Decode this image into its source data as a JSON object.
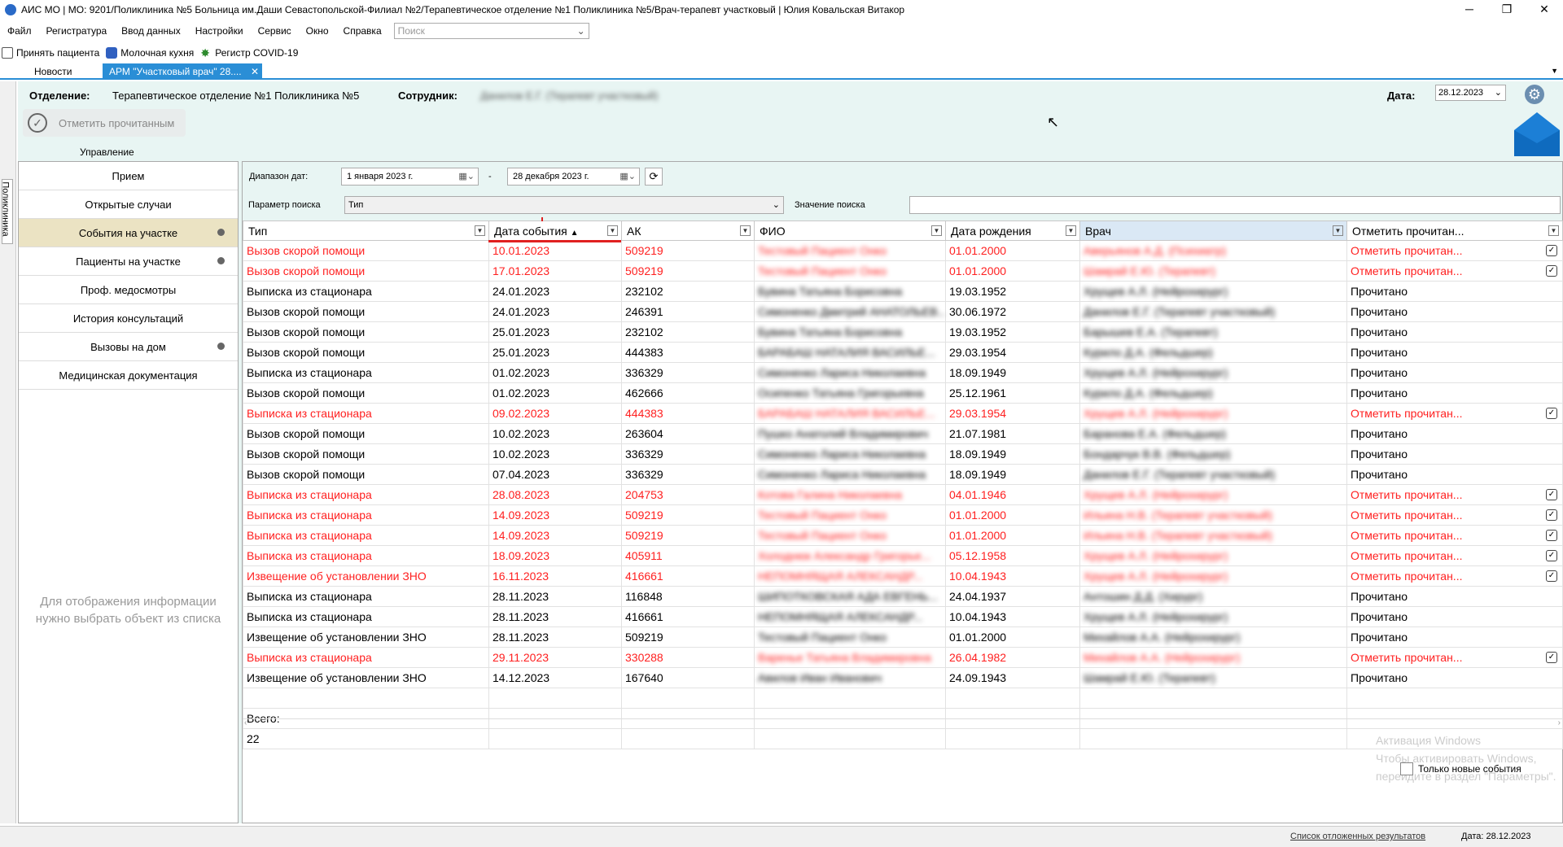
{
  "window": {
    "title": "АИС МО | МО: 9201/Поликлиника №5 Больница им.Даши Севастопольской-Филиал №2/Терапевтическое отделение №1 Поликлиника №5/Врач-терапевт участковый | Юлия Ковальская Витакор",
    "minimize": "─",
    "maximize": "❐",
    "close": "✕"
  },
  "menu": {
    "items": [
      "Файл",
      "Регистратура",
      "Ввод данных",
      "Настройки",
      "Сервис",
      "Окно",
      "Справка"
    ],
    "search_placeholder": "Поиск"
  },
  "toolbar": {
    "accept_patient": "Принять пациента",
    "milk_kitchen": "Молочная кухня",
    "covid_registry": "Регистр COVID-19"
  },
  "tabs": {
    "news": "Новости",
    "active": "АРМ \"Участковый врач\" 28....",
    "close": "✕"
  },
  "side_label": "Поликлиника",
  "header": {
    "department_label": "Отделение:",
    "department_value": "Терапевтическое отделение №1 Поликлиника №5",
    "employee_label": "Сотрудник:",
    "employee_value": "Данилов Е.Г. (Терапевт участковый)",
    "date_label": "Дата:",
    "date_value": "28.12.2023"
  },
  "actions": {
    "mark_read": "Отметить прочитанным",
    "management": "Управление"
  },
  "nav": {
    "items": [
      "Прием",
      "Открытые случаи",
      "События на участке",
      "Пациенты на участке",
      "Проф. медосмотры",
      "История консультаций",
      "Вызовы на дом",
      "Медицинская документация"
    ],
    "info_line1": "Для отображения информации",
    "info_line2": "нужно выбрать объект из списка"
  },
  "filters": {
    "date_range_label": "Диапазон дат:",
    "date_from": "1  января  2023 г.",
    "date_sep": "-",
    "date_to": "28  декабря  2023 г.",
    "param_label": "Параметр поиска",
    "param_value": "Тип",
    "search_value_label": "Значение поиска"
  },
  "table": {
    "columns": [
      "Тип",
      "Дата события",
      "АК",
      "ФИО",
      "Дата рождения",
      "Врач",
      "Отметить прочитан..."
    ],
    "rows": [
      {
        "type": "Вызов скорой помощи",
        "date": "10.01.2023",
        "ak": "509219",
        "fio": "Тестовый Пациент Онко",
        "birth": "01.01.2000",
        "doctor": "Аверьянов А.Д. (Психиатр)",
        "status": "Отметить прочитан...",
        "red": true
      },
      {
        "type": "Вызов скорой помощи",
        "date": "17.01.2023",
        "ak": "509219",
        "fio": "Тестовый Пациент Онко",
        "birth": "01.01.2000",
        "doctor": "Шамрай Е.Ю. (Терапевт)",
        "status": "Отметить прочитан...",
        "red": true
      },
      {
        "type": "Выписка из стационара",
        "date": "24.01.2023",
        "ak": "232102",
        "fio": "Бувина Татьяна Борисовна",
        "birth": "19.03.1952",
        "doctor": "Хрущев А.Л. (Нейрохирург)",
        "status": "Прочитано",
        "red": false
      },
      {
        "type": "Вызов скорой помощи",
        "date": "24.01.2023",
        "ak": "246391",
        "fio": "Симоненко Дмитрий АНАТОЛЬЕВ...",
        "birth": "30.06.1972",
        "doctor": "Данилов Е.Г. (Терапевт участковый)",
        "status": "Прочитано",
        "red": false
      },
      {
        "type": "Вызов скорой помощи",
        "date": "25.01.2023",
        "ak": "232102",
        "fio": "Бувина Татьяна Борисовна",
        "birth": "19.03.1952",
        "doctor": "Барышев Е.А. (Терапевт)",
        "status": "Прочитано",
        "red": false
      },
      {
        "type": "Вызов скорой помощи",
        "date": "25.01.2023",
        "ak": "444383",
        "fio": "БАРАБАШ НАТАЛИЯ ВАСИЛЬЕ...",
        "birth": "29.03.1954",
        "doctor": "Курило Д.А. (Фельдшер)",
        "status": "Прочитано",
        "red": false
      },
      {
        "type": "Выписка из стационара",
        "date": "01.02.2023",
        "ak": "336329",
        "fio": "Симоненко Лариса Николаевна",
        "birth": "18.09.1949",
        "doctor": "Хрущев А.Л. (Нейрохирург)",
        "status": "Прочитано",
        "red": false
      },
      {
        "type": "Вызов скорой помощи",
        "date": "01.02.2023",
        "ak": "462666",
        "fio": "Осипенко Татьяна Григорьевна",
        "birth": "25.12.1961",
        "doctor": "Курило Д.А. (Фельдшер)",
        "status": "Прочитано",
        "red": false
      },
      {
        "type": "Выписка из стационара",
        "date": "09.02.2023",
        "ak": "444383",
        "fio": "БАРАБАШ НАТАЛИЯ ВАСИЛЬЕ...",
        "birth": "29.03.1954",
        "doctor": "Хрущев А.Л. (Нейрохирург)",
        "status": "Отметить прочитан...",
        "red": true
      },
      {
        "type": "Вызов скорой помощи",
        "date": "10.02.2023",
        "ak": "263604",
        "fio": "Пушко Анатолий Владимирович",
        "birth": "21.07.1981",
        "doctor": "Баранова Е.А. (Фельдшер)",
        "status": "Прочитано",
        "red": false
      },
      {
        "type": "Вызов скорой помощи",
        "date": "10.02.2023",
        "ak": "336329",
        "fio": "Симоненко Лариса Николаевна",
        "birth": "18.09.1949",
        "doctor": "Бондарчук В.В. (Фельдшер)",
        "status": "Прочитано",
        "red": false
      },
      {
        "type": "Вызов скорой помощи",
        "date": "07.04.2023",
        "ak": "336329",
        "fio": "Симоненко Лариса Николаевна",
        "birth": "18.09.1949",
        "doctor": "Данилов Е.Г. (Терапевт участковый)",
        "status": "Прочитано",
        "red": false
      },
      {
        "type": "Выписка из стационара",
        "date": "28.08.2023",
        "ak": "204753",
        "fio": "Котова Галина Николаевна",
        "birth": "04.01.1946",
        "doctor": "Хрущев А.Л. (Нейрохирург)",
        "status": "Отметить прочитан...",
        "red": true
      },
      {
        "type": "Выписка из стационара",
        "date": "14.09.2023",
        "ak": "509219",
        "fio": "Тестовый Пациент Онко",
        "birth": "01.01.2000",
        "doctor": "Ильина Н.В. (Терапевт участковый)",
        "status": "Отметить прочитан...",
        "red": true
      },
      {
        "type": "Выписка из стационара",
        "date": "14.09.2023",
        "ak": "509219",
        "fio": "Тестовый Пациент Онко",
        "birth": "01.01.2000",
        "doctor": "Ильина Н.В. (Терапевт участковый)",
        "status": "Отметить прочитан...",
        "red": true
      },
      {
        "type": "Выписка из стационара",
        "date": "18.09.2023",
        "ak": "405911",
        "fio": "Холоднюк Александр Григорье...",
        "birth": "05.12.1958",
        "doctor": "Хрущев А.Л. (Нейрохирург)",
        "status": "Отметить прочитан...",
        "red": true
      },
      {
        "type": "Извещение об установлении ЗНО",
        "date": "16.11.2023",
        "ak": "416661",
        "fio": "НЕПОМНЯЩАЯ АЛЕКСАНДР...",
        "birth": "10.04.1943",
        "doctor": "Хрущев А.Л. (Нейрохирург)",
        "status": "Отметить прочитан...",
        "red": true
      },
      {
        "type": "Выписка из стационара",
        "date": "28.11.2023",
        "ak": "116848",
        "fio": "ШИПОТКОВСКАЯ АДА ЕВГЕНЬ...",
        "birth": "24.04.1937",
        "doctor": "Антошин Д.Д. (Хирург)",
        "status": "Прочитано",
        "red": false
      },
      {
        "type": "Выписка из стационара",
        "date": "28.11.2023",
        "ak": "416661",
        "fio": "НЕПОМНЯЩАЯ АЛЕКСАНДР...",
        "birth": "10.04.1943",
        "doctor": "Хрущев А.Л. (Нейрохирург)",
        "status": "Прочитано",
        "red": false
      },
      {
        "type": "Извещение об установлении ЗНО",
        "date": "28.11.2023",
        "ak": "509219",
        "fio": "Тестовый Пациент Онко",
        "birth": "01.01.2000",
        "doctor": "Михайлов А.А. (Нейрохирург)",
        "status": "Прочитано",
        "red": false
      },
      {
        "type": "Выписка из стационара",
        "date": "29.11.2023",
        "ak": "330288",
        "fio": "Варенье Татьяна Владимировна",
        "birth": "26.04.1982",
        "doctor": "Михайлов А.А. (Нейрохирург)",
        "status": "Отметить прочитан...",
        "red": true
      },
      {
        "type": "Извещение об установлении ЗНО",
        "date": "14.12.2023",
        "ak": "167640",
        "fio": "Авилов Иван Иванович",
        "birth": "24.09.1943",
        "doctor": "Шамрай Е.Ю. (Терапевт)",
        "status": "Прочитано",
        "red": false
      }
    ],
    "total_label": "Всего:",
    "total_value": "22"
  },
  "new_only_label": "Только новые события",
  "watermark": {
    "line1": "Активация Windows",
    "line2": "Чтобы активировать Windows, перейдите в раздел \"Параметры\"."
  },
  "statusbar": {
    "deferred_link": "Список отложенных результатов",
    "date": "Дата: 28.12.2023"
  },
  "colors": {
    "accent": "#2a8ed6",
    "panel_bg": "#e8f5f3",
    "active_nav": "#ebe3c3",
    "unread_text": "#ff2020"
  }
}
